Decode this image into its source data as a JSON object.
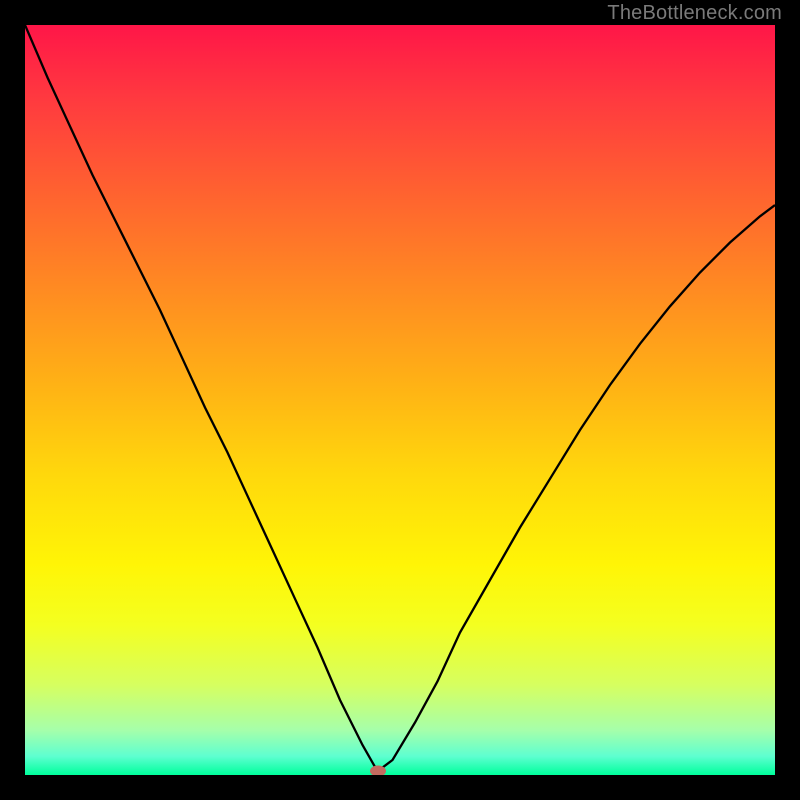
{
  "credit": "TheBottleneck.com",
  "colors": {
    "frame": "#000000",
    "curve": "#000000",
    "marker": "#c36b60"
  },
  "chart_data": {
    "type": "line",
    "title": "",
    "xlabel": "",
    "ylabel": "",
    "xlim": [
      0,
      100
    ],
    "ylim": [
      0,
      100
    ],
    "grid": false,
    "legend": false,
    "min_point": {
      "x": 47,
      "y": 0.5
    },
    "series": [
      {
        "name": "bottleneck-curve",
        "x": [
          0,
          3,
          6,
          9,
          12,
          15,
          18,
          21,
          24,
          27,
          30,
          33,
          36,
          39,
          42,
          45,
          47,
          49,
          52,
          55,
          58,
          62,
          66,
          70,
          74,
          78,
          82,
          86,
          90,
          94,
          98,
          100
        ],
        "y": [
          100,
          93,
          86.5,
          80,
          74,
          68,
          62,
          55.5,
          49,
          43,
          36.5,
          30,
          23.5,
          17,
          10,
          4,
          0.5,
          2,
          7,
          12.5,
          19,
          26,
          33,
          39.5,
          46,
          52,
          57.5,
          62.5,
          67,
          71,
          74.5,
          76
        ]
      }
    ],
    "gradient_stops": [
      {
        "pos": 0,
        "color": "#ff1648"
      },
      {
        "pos": 0.5,
        "color": "#ffd80c"
      },
      {
        "pos": 1,
        "color": "#00ff9c"
      }
    ]
  }
}
